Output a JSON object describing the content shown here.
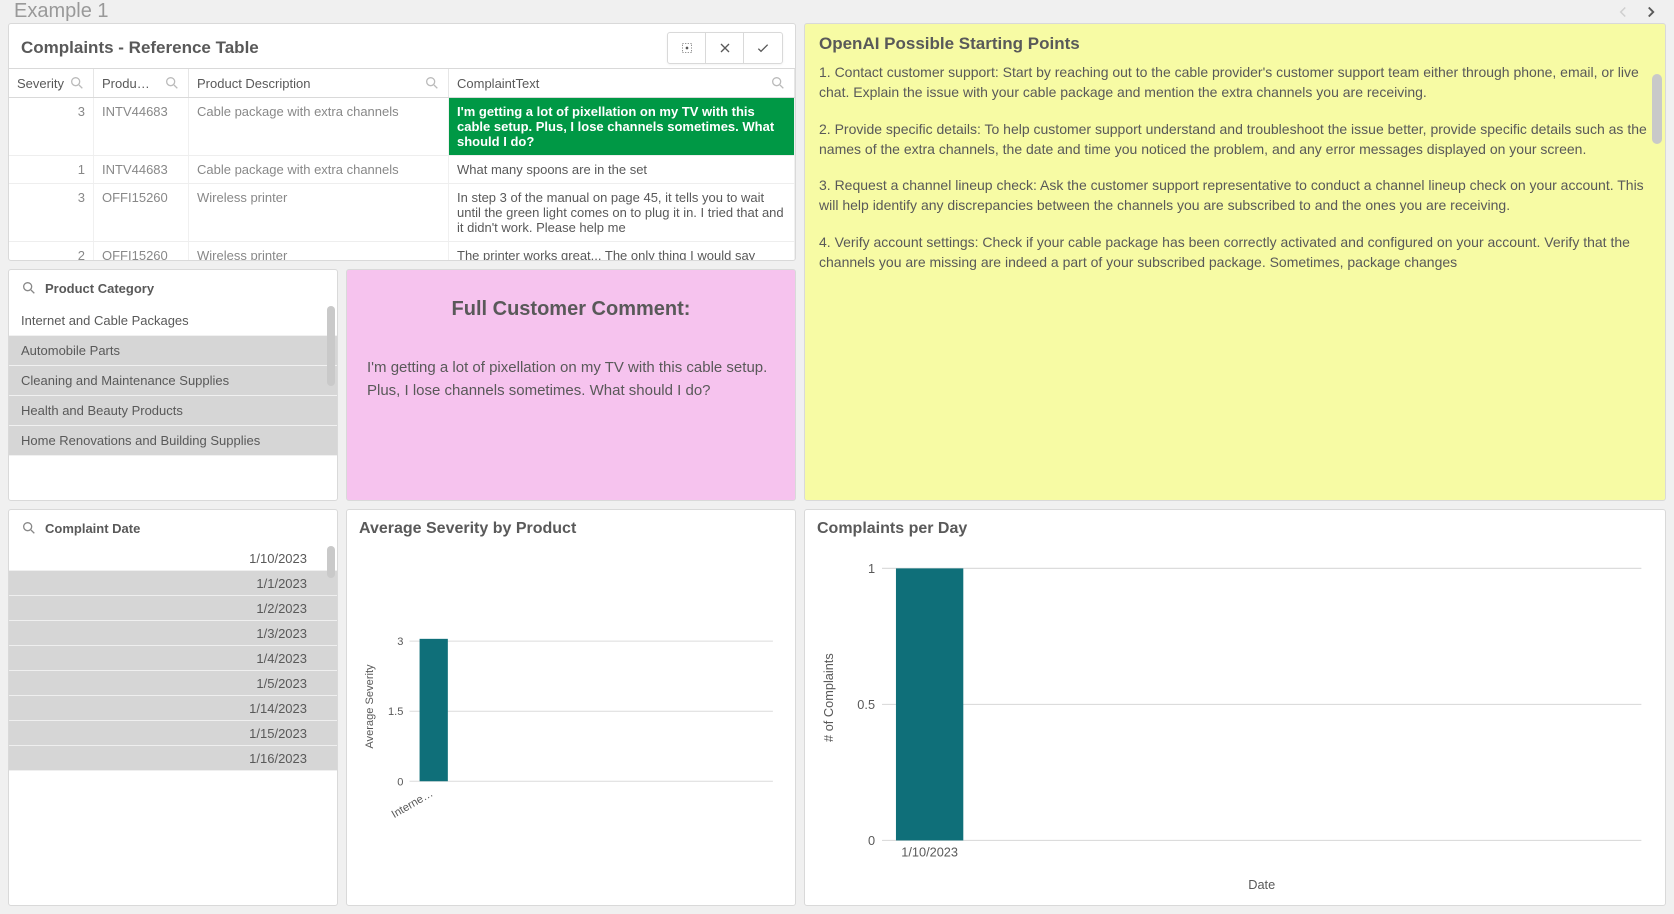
{
  "header": {
    "title": "Example 1"
  },
  "complaints_table": {
    "title": "Complaints - Reference Table",
    "columns": {
      "sev": "Severity",
      "prod": "Produ…",
      "pdesc": "Product Description",
      "ctxt": "ComplaintText"
    },
    "rows": [
      {
        "sev": "3",
        "prod": "INTV44683",
        "pdesc": "Cable package with extra channels",
        "ctxt": "I'm getting a lot of pixellation on my TV with this cable setup. Plus, I lose channels sometimes. What should I do?",
        "selected": true
      },
      {
        "sev": "1",
        "prod": "INTV44683",
        "pdesc": "Cable package with extra channels",
        "ctxt": "What many spoons are in the set"
      },
      {
        "sev": "3",
        "prod": "OFFI15260",
        "pdesc": "Wireless printer",
        "ctxt": "In step 3 of the manual on page 45, it tells you to wait until the green light comes on to plug it in. I tried that and it didn't work. Please help me"
      },
      {
        "sev": "2",
        "prod": "OFFI15260",
        "pdesc": "Wireless printer",
        "ctxt": "The printer works great... The only thing I would say about it is that the software used for it does"
      }
    ]
  },
  "ai": {
    "title": "OpenAI Possible Starting Points",
    "paras": [
      "1. Contact customer support: Start by reaching out to the cable provider's customer support team either through phone, email, or live chat. Explain the issue with your cable package and mention the extra channels you are receiving.",
      "2. Provide specific details: To help customer support understand and troubleshoot the issue better, provide specific details such as the names of the extra channels, the date and time you noticed the problem, and any error messages displayed on your screen.",
      "3. Request a channel lineup check: Ask the customer support representative to conduct a channel lineup check on your account. This will help identify any discrepancies between the channels you are subscribed to and the ones you are receiving.",
      "4. Verify account settings: Check if your cable package has been correctly activated and configured on your account. Verify that the channels you are missing are indeed a part of your subscribed package. Sometimes, package changes"
    ]
  },
  "categories": {
    "title": "Product Category",
    "items": [
      {
        "label": "Internet and Cable Packages",
        "selected": true
      },
      {
        "label": "Automobile Parts"
      },
      {
        "label": "Cleaning and Maintenance Supplies"
      },
      {
        "label": "Health and Beauty Products"
      },
      {
        "label": "Home Renovations and Building Supplies"
      }
    ]
  },
  "dates": {
    "title": "Complaint Date",
    "items": [
      {
        "label": "1/10/2023",
        "selected": true
      },
      {
        "label": "1/1/2023"
      },
      {
        "label": "1/2/2023"
      },
      {
        "label": "1/3/2023"
      },
      {
        "label": "1/4/2023"
      },
      {
        "label": "1/5/2023"
      },
      {
        "label": "1/14/2023"
      },
      {
        "label": "1/15/2023"
      },
      {
        "label": "1/16/2023"
      }
    ]
  },
  "comment": {
    "title": "Full Customer Comment:",
    "text": "I'm getting a lot of pixellation on my TV with this cable setup. Plus, I lose channels sometimes. What should I do?"
  },
  "chart_data": [
    {
      "id": "avg_sev",
      "type": "bar",
      "title": "Average Severity by Product",
      "ylabel": "Average Severity",
      "xlabel": "",
      "categories": [
        "Interne…"
      ],
      "values": [
        3.05
      ],
      "ticks": [
        0,
        1.5,
        3
      ],
      "ylim": [
        0,
        3.2
      ],
      "bar_color": "#0f6f79"
    },
    {
      "id": "complaints_per_day",
      "type": "bar",
      "title": "Complaints per Day",
      "ylabel": "# of Complaints",
      "xlabel": "Date",
      "categories": [
        "1/10/2023"
      ],
      "values": [
        1
      ],
      "ticks": [
        0,
        0.5,
        1
      ],
      "ylim": [
        0,
        1.05
      ],
      "bar_color": "#0f6f79"
    }
  ]
}
